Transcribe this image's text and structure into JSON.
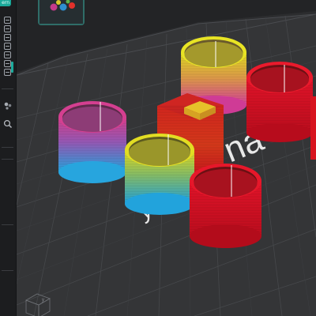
{
  "left_toolbar": {
    "top_tab_label": "ern",
    "buttons": [
      "collapse",
      "collapse",
      "collapse",
      "collapse",
      "collapse",
      "collapse",
      "collapse"
    ],
    "search_icon": "magnifier-icon",
    "settings_icon": "gear-cluster-icon"
  },
  "viewport": {
    "plate_logo_text": "na",
    "plate_logo_text_2": "y",
    "navigation_cube_axis_label": "y",
    "objects": [
      {
        "name": "cylinder-magenta-cyan",
        "color_top": "#d9408c",
        "color_bottom": "#2aa6e0"
      },
      {
        "name": "cylinder-yellow-cyan",
        "color_top": "#e6dd1f",
        "color_bottom": "#22a6dd"
      },
      {
        "name": "cylinder-yellow-magenta",
        "color_top": "#e5e021",
        "color_bottom": "#d84399"
      },
      {
        "name": "block-red-yellow",
        "color_top": "#e2c321",
        "color_bottom": "#d41b1b"
      },
      {
        "name": "cylinder-red",
        "color_top": "#e5152a",
        "color_bottom": "#c7101e"
      },
      {
        "name": "cylinder-red-front",
        "color_top": "#e41424",
        "color_bottom": "#c40f1f"
      }
    ]
  },
  "colors": {
    "accent": "#1aa99a",
    "toolbar_bg": "#1c1d1f",
    "viewport_bg": "#2c2d2f",
    "bed_bg": "#343537",
    "grid_line": "#46484b"
  }
}
